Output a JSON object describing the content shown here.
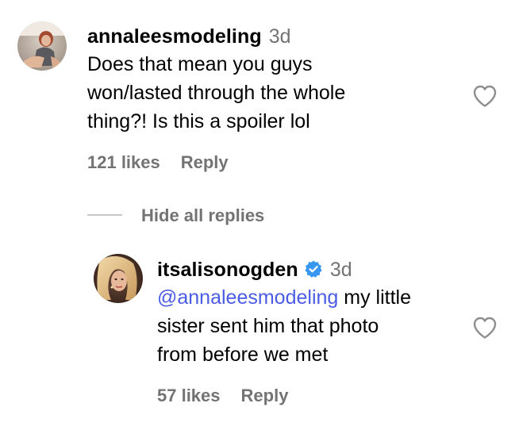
{
  "comment": {
    "username": "annaleesmodeling",
    "timestamp": "3d",
    "text_lines": [
      "Does that mean you guys",
      "won/lasted through the whole",
      "thing?! Is this a spoiler lol"
    ],
    "likes": "121 likes",
    "reply_label": "Reply",
    "avatar_icon": "avatar-photo-icon",
    "like_icon": "heart-outline-icon"
  },
  "replies_toggle": {
    "label": "Hide all replies"
  },
  "reply": {
    "username": "itsalisonogden",
    "verified_icon": "verified-badge-icon",
    "timestamp": "3d",
    "mention": "@annaleesmodeling",
    "text_line1_rest": " my little",
    "text_lines_rest": [
      "sister sent him that photo",
      "from before we met"
    ],
    "likes": "57 likes",
    "reply_label": "Reply",
    "avatar_icon": "avatar-photo-icon",
    "like_icon": "heart-outline-icon"
  },
  "colors": {
    "secondary_text": "#737373",
    "mention": "#4a5ce6",
    "verified_badge": "#3897f0",
    "heart_stroke": "#8e8e8e"
  }
}
